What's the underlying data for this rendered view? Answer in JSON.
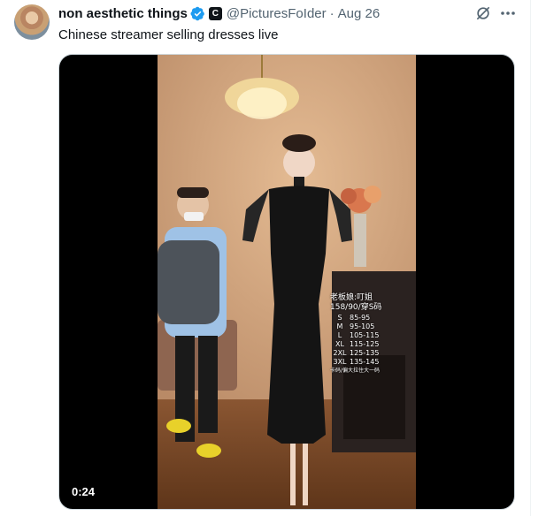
{
  "tweet": {
    "display_name": "non aesthetic things",
    "handle": "@PicturesFoIder",
    "separator": "·",
    "date": "Aug 26",
    "text": "Chinese streamer selling dresses live",
    "affiliate_badge": "C"
  },
  "media": {
    "duration": "0:24",
    "overlay": {
      "header_line1": "老板娘:叮姐",
      "header_line2": "158/90/穿S码",
      "sizes": [
        {
          "size": "S",
          "range": "85-95"
        },
        {
          "size": "M",
          "range": "95-105"
        },
        {
          "size": "L",
          "range": "105-115"
        },
        {
          "size": "XL",
          "range": "115-125"
        },
        {
          "size": "2XL",
          "range": "125-135"
        },
        {
          "size": "3XL",
          "range": "135-145"
        }
      ],
      "footnote": "卡码/偏大拉住大一码"
    }
  },
  "icons": {
    "verified": "verified-badge-icon",
    "grok": "grok-icon",
    "more": "more-icon"
  },
  "colors": {
    "verified_blue": "#1d9bf0",
    "muted_text": "#536471",
    "primary_text": "#0f1419"
  }
}
